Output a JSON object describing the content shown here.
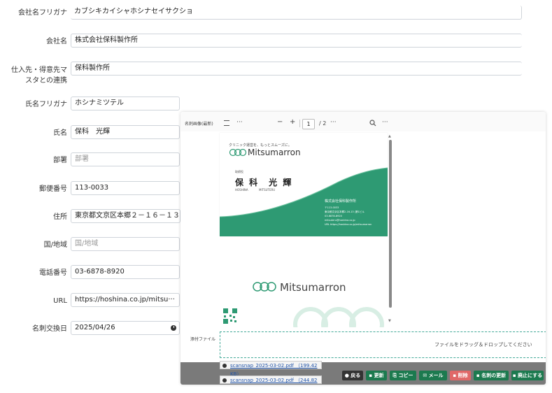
{
  "form": {
    "rows": [
      {
        "label": "会社名フリガナ",
        "value": "カブシキカイシャホシナセイサクショ"
      },
      {
        "label": "会社名",
        "value": "株式会社保科製作所"
      },
      {
        "label": "仕入先・得意先マスタとの連携",
        "label_line1": "仕入先・得意先マ",
        "label_line2": "スタとの連携",
        "value": "保科製作所"
      },
      {
        "label": "氏名フリガナ",
        "value": "ホシナミツテル"
      },
      {
        "label": "氏名",
        "value": "保科　光輝"
      },
      {
        "label": "部署",
        "placeholder": "部署"
      },
      {
        "label": "郵便番号",
        "value": "113-0033"
      },
      {
        "label": "住所",
        "value": "東京都文京区本郷２－１６－１３"
      },
      {
        "label": "国/地域",
        "placeholder": "国/地域"
      },
      {
        "label": "電話番号",
        "value": "03-6878-8920"
      },
      {
        "label": "URL",
        "value": "https://hoshina.co.jp/mitsu···"
      },
      {
        "label": "名刺交換日",
        "value": "2025/04/26"
      }
    ]
  },
  "viewer": {
    "section_label": "名刺画像(最新)",
    "page_current": "1",
    "page_total": "/ 2",
    "minus": "−",
    "plus": "+",
    "more": "···"
  },
  "card_front": {
    "tagline": "クリニック運営を、もっとスムーズに。",
    "brand": "Mitsumarron",
    "title": "取締役",
    "name": "保 科　光 輝",
    "name_romaji_1": "HOSHINA",
    "name_romaji_2": "MITSUTERU",
    "company": "株式会社保科製作所",
    "zip": "〒113-0033",
    "address": "東京都文京区本郷2-16-13 (第1ビル",
    "tel": "03-6878-8920",
    "email": "mitsuteru@hoshina.co.jp",
    "url": "URL https://hoshina.co.jp/mitsumarron"
  },
  "card_back": {
    "brand": "Mitsumarron"
  },
  "attachments": {
    "label": "添付ファイル",
    "drop_text": "ファイルをドラッグ＆ドロップしてください",
    "files": [
      "scansnap_2025-03-02.pdf （199.42 KB）",
      "scansnap_2025-03-02.pdf （244.82 KB）"
    ]
  },
  "actions": {
    "back": "戻る",
    "update": "更新",
    "copy": "コピー",
    "mail": "メール",
    "delete": "削除",
    "card_update": "名刺の更新",
    "discontinue": "廃止にする"
  },
  "colors": {
    "accent_green": "#2e9a73",
    "button_green": "#1c7a4f",
    "danger": "#e06868"
  }
}
